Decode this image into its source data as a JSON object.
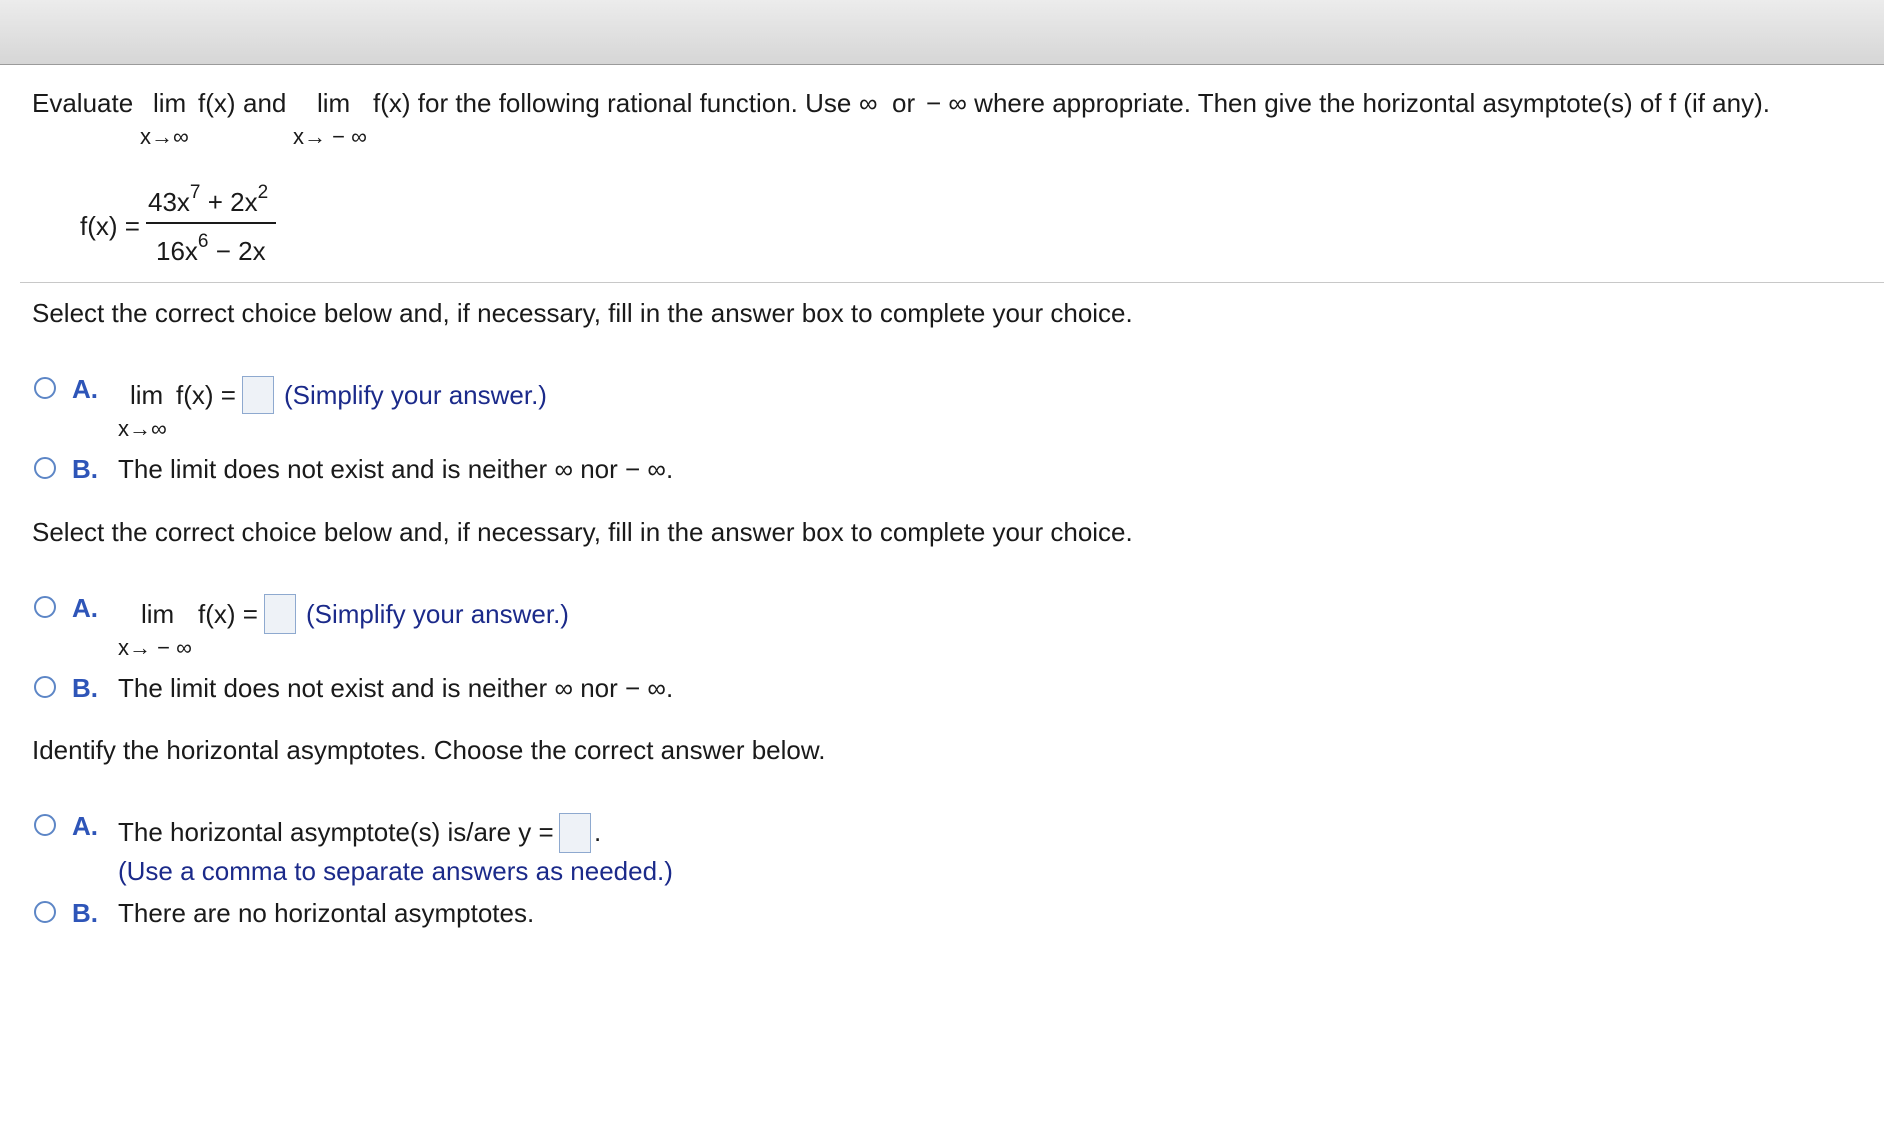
{
  "window": {
    "top_bar": ""
  },
  "question": {
    "evaluate": "Evaluate",
    "lim": "lim",
    "fx": "f(x)",
    "and": "and",
    "lim2": "lim",
    "fx_for": "f(x) for the following rational function. Use",
    "inf": "∞",
    "or": "or",
    "neg_inf_where": "− ∞ where appropriate. Then give the horizontal asymptote(s) of f (if any).",
    "sub_pos": "x→∞",
    "sub_neg": "x→ − ∞"
  },
  "function": {
    "lhs": "f(x) =",
    "num_a": "43x",
    "num_a_exp": "7",
    "num_b": "+ 2x",
    "num_b_exp": "2",
    "den_a": "16x",
    "den_a_exp": "6",
    "den_b": "− 2x"
  },
  "part1": {
    "prompt": "Select the correct choice below and, if necessary, fill in the answer box to complete your choice.",
    "a_letter": "A.",
    "a_lim": "lim",
    "a_fx": "f(x) =",
    "a_sub": "x→∞",
    "a_note": "(Simplify your answer.)",
    "b_letter": "B.",
    "b_text": "The limit does not exist and is neither ∞ nor  − ∞."
  },
  "part2": {
    "prompt": "Select the correct choice below and, if necessary, fill in the answer box to complete your choice.",
    "a_letter": "A.",
    "a_lim": "lim",
    "a_fx": "f(x) =",
    "a_sub": "x→ − ∞",
    "a_note": "(Simplify your answer.)",
    "b_letter": "B.",
    "b_text": "The limit does not exist and is neither ∞ nor  − ∞."
  },
  "part3": {
    "prompt": "Identify the horizontal asymptotes. Choose the correct answer below.",
    "a_letter": "A.",
    "a_text": "The horizontal asymptote(s) is/are y =",
    "a_period": ".",
    "a_note": "(Use a comma to separate answers as needed.)",
    "b_letter": "B.",
    "b_text": "There are no horizontal asymptotes."
  },
  "colors": {
    "choice_letter": "#2e55b8",
    "note_text": "#1b2a8a",
    "radio_border": "#5d86c6",
    "answer_box_fill": "#eef2f7"
  }
}
